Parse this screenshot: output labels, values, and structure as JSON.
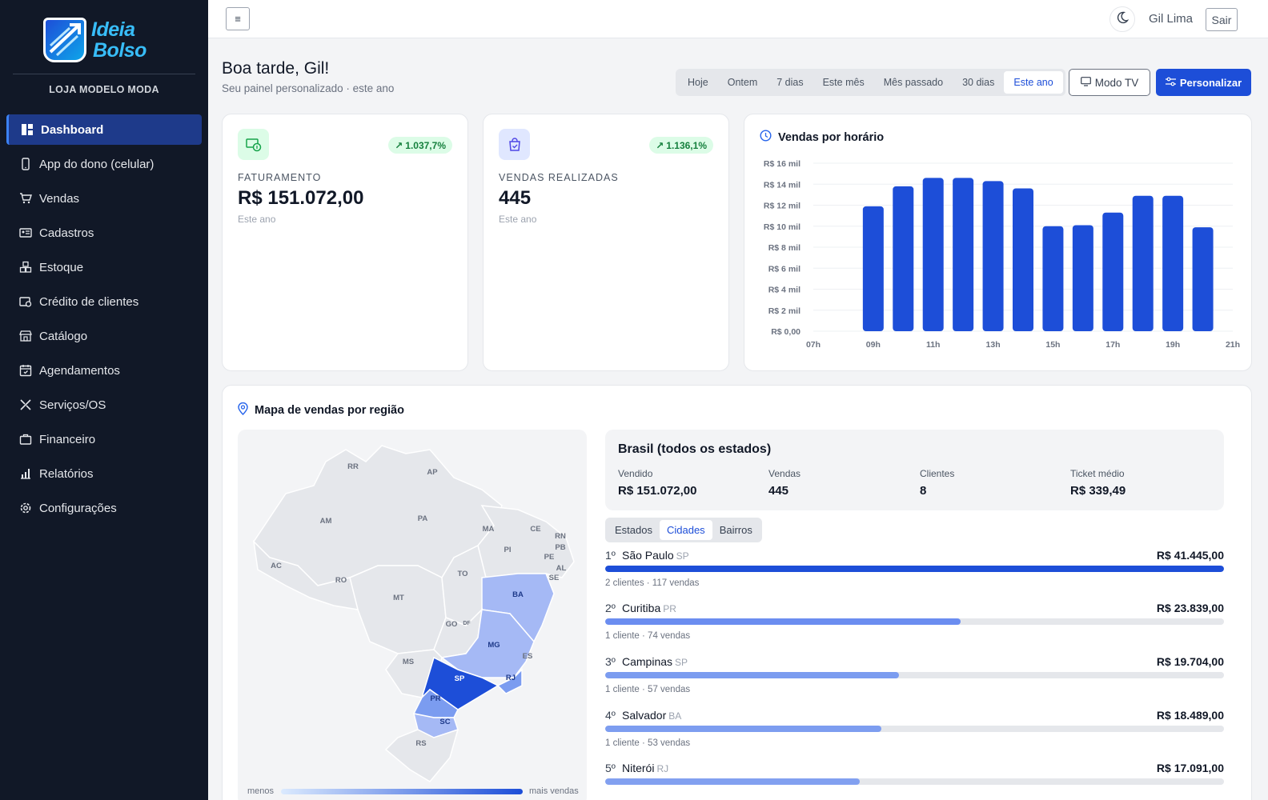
{
  "brand": {
    "line1": "Ideia",
    "line2": "Bolso",
    "store": "LOJA MODELO MODA"
  },
  "sidebar": {
    "items": [
      {
        "label": "Dashboard",
        "icon": "dashboard-icon",
        "active": true
      },
      {
        "label": "App do dono (celular)",
        "icon": "phone-icon"
      },
      {
        "label": "Vendas",
        "icon": "cart-icon"
      },
      {
        "label": "Cadastros",
        "icon": "id-card-icon"
      },
      {
        "label": "Estoque",
        "icon": "boxes-icon"
      },
      {
        "label": "Crédito de clientes",
        "icon": "wallet-icon"
      },
      {
        "label": "Catálogo",
        "icon": "store-icon"
      },
      {
        "label": "Agendamentos",
        "icon": "calendar-icon"
      },
      {
        "label": "Serviços/OS",
        "icon": "tools-icon"
      },
      {
        "label": "Financeiro",
        "icon": "briefcase-icon"
      },
      {
        "label": "Relatórios",
        "icon": "bar-chart-icon"
      },
      {
        "label": "Configurações",
        "icon": "gear-icon"
      }
    ]
  },
  "topbar": {
    "menu_label": "≡",
    "user": "Gil Lima",
    "logout": "Sair"
  },
  "header": {
    "greeting": "Boa tarde, Gil!",
    "subtitle": "Seu painel personalizado · este ano",
    "periods": [
      "Hoje",
      "Ontem",
      "7 dias",
      "Este mês",
      "Mês passado",
      "30 dias",
      "Este ano"
    ],
    "active_period": 6,
    "tv_label": "Modo TV",
    "customize_label": "Personalizar"
  },
  "stats": [
    {
      "label": "FATURAMENTO",
      "value": "R$ 151.072,00",
      "period": "Este ano",
      "change": "1.037,7%",
      "icon": "money-icon"
    },
    {
      "label": "VENDAS REALIZADAS",
      "value": "445",
      "period": "Este ano",
      "change": "1.136,1%",
      "icon": "shopping-bag-icon"
    }
  ],
  "chart_data": {
    "type": "bar",
    "title": "Vendas por horário",
    "x": [
      9,
      10,
      11,
      12,
      13,
      14,
      15,
      16,
      17,
      18,
      19,
      20
    ],
    "values": [
      11900,
      13800,
      14600,
      14600,
      14300,
      13600,
      10000,
      10100,
      11300,
      12900,
      12900,
      9900
    ],
    "xtick_labels": [
      "07h",
      "09h",
      "11h",
      "13h",
      "15h",
      "17h",
      "19h",
      "21h"
    ],
    "xlim": [
      7,
      21
    ],
    "ytick_labels": [
      "R$ 16 mil",
      "R$ 14 mil",
      "R$ 12 mil",
      "R$ 10 mil",
      "R$ 8 mil",
      "R$ 6 mil",
      "R$ 4 mil",
      "R$ 2 mil",
      "R$ 0,00"
    ],
    "ylim": [
      0,
      16000
    ],
    "grid": true,
    "color": "#1d4ed8"
  },
  "map": {
    "title": "Mapa de vendas por região",
    "states": [
      "RR",
      "AP",
      "AM",
      "PA",
      "MA",
      "CE",
      "RN",
      "PB",
      "PE",
      "AL",
      "SE",
      "PI",
      "AC",
      "RO",
      "TO",
      "BA",
      "MT",
      "GO",
      "DF",
      "MG",
      "ES",
      "MS",
      "SP",
      "RJ",
      "PR",
      "SC",
      "RS"
    ],
    "legend_min": "menos",
    "legend_max": "mais vendas"
  },
  "summary": {
    "title": "Brasil (todos os estados)",
    "cols": [
      {
        "label": "Vendido",
        "value": "R$ 151.072,00"
      },
      {
        "label": "Vendas",
        "value": "445"
      },
      {
        "label": "Clientes",
        "value": "8"
      },
      {
        "label": "Ticket médio",
        "value": "R$ 339,49"
      }
    ]
  },
  "ranking": {
    "tabs": [
      "Estados",
      "Cidades",
      "Bairros"
    ],
    "active_tab": 1,
    "items": [
      {
        "pos": "1º",
        "city": "São Paulo",
        "uf": "SP",
        "value": "R$ 41.445,00",
        "meta": "2 clientes · 117 vendas",
        "pct": 100,
        "color": "#1d4ed8"
      },
      {
        "pos": "2º",
        "city": "Curitiba",
        "uf": "PR",
        "value": "R$ 23.839,00",
        "meta": "1 cliente · 74 vendas",
        "pct": 57.5,
        "color": "#6b8df0"
      },
      {
        "pos": "3º",
        "city": "Campinas",
        "uf": "SP",
        "value": "R$ 19.704,00",
        "meta": "1 cliente · 57 vendas",
        "pct": 47.5,
        "color": "#7b9cf0"
      },
      {
        "pos": "4º",
        "city": "Salvador",
        "uf": "BA",
        "value": "R$ 18.489,00",
        "meta": "1 cliente · 53 vendas",
        "pct": 44.6,
        "color": "#7d9df0"
      },
      {
        "pos": "5º",
        "city": "Niterói",
        "uf": "RJ",
        "value": "R$ 17.091,00",
        "meta": "",
        "pct": 41.2,
        "color": "#82a0f0"
      }
    ]
  }
}
